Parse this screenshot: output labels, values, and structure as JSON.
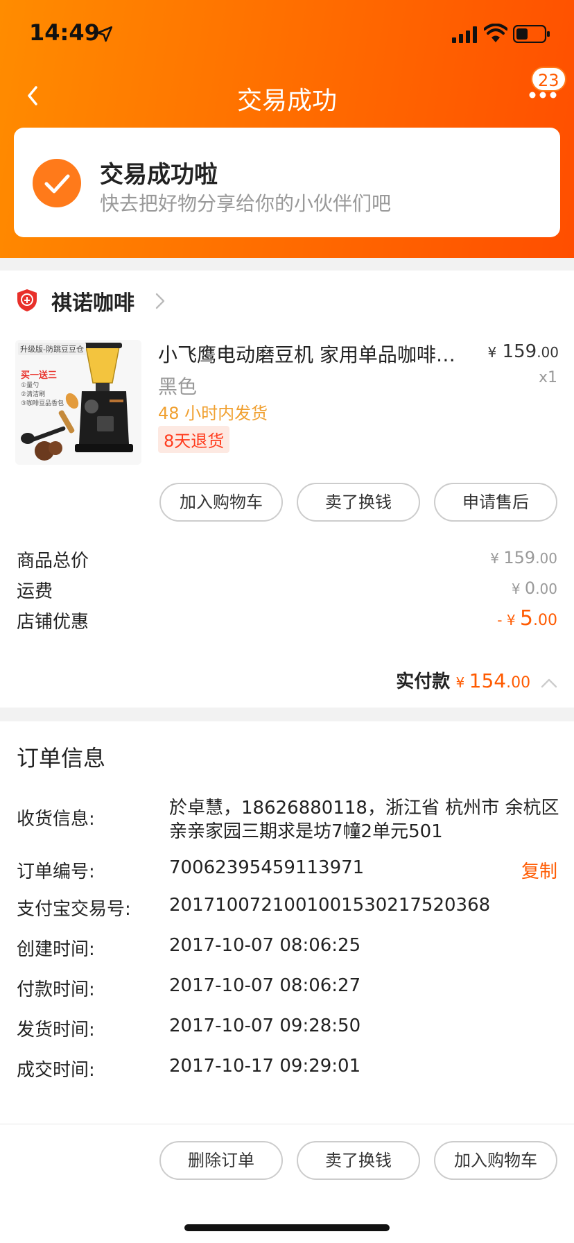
{
  "status_bar": {
    "time": "14:49"
  },
  "nav": {
    "title": "交易成功",
    "badge_count": "23"
  },
  "success": {
    "title": "交易成功啦",
    "subtitle": "快去把好物分享给你的小伙伴们吧"
  },
  "shop": {
    "name": "祺诺咖啡"
  },
  "product": {
    "name": "小飞鹰电动磨豆机 家用单品咖啡磨豆机",
    "price_symbol": "¥",
    "price_int": "159",
    "price_dec": ".00",
    "quantity": "x1",
    "color": "黑色",
    "shipping": "48 小时内发货",
    "return_policy": "8天退货",
    "image_texts": {
      "banner": "升级版-防跳豆豆仓",
      "promo": "买一送三",
      "gift1": "①量勺",
      "gift2": "②清洁刷",
      "gift3": "③咖啡豆品香包"
    }
  },
  "product_actions": [
    "加入购物车",
    "卖了换钱",
    "申请售后"
  ],
  "fees": [
    {
      "label": "商品总价",
      "prefix": "¥ ",
      "int": "159",
      "dec": ".00"
    },
    {
      "label": "运费",
      "prefix": "¥ ",
      "int": "0",
      "dec": ".00"
    },
    {
      "label": "店铺优惠",
      "prefix": "- ¥ ",
      "int": "5",
      "dec": ".00"
    }
  ],
  "paid": {
    "label": "实付款",
    "symbol": "¥ ",
    "int": "154",
    "dec": ".00"
  },
  "order_info": {
    "title": "订单信息",
    "address_label": "收货信息:",
    "address_line1": "於卓慧，18626880118，浙江省 杭州市 余杭区",
    "address_line2": "亲亲家园三期求是坊7幢2单元501",
    "order_no_label": "订单编号:",
    "order_no": "70062395459113971",
    "copy_label": "复制",
    "alipay_label": "支付宝交易号:",
    "alipay_no": "2017100721001001530217520368",
    "created_label": "创建时间:",
    "created": "2017-10-07 08:06:25",
    "paid_label": "付款时间:",
    "paid_time": "2017-10-07 08:06:27",
    "shipped_label": "发货时间:",
    "shipped": "2017-10-07 09:28:50",
    "closed_label": "成交时间:",
    "closed": "2017-10-17 09:29:01"
  },
  "bottom_actions": [
    "删除订单",
    "卖了换钱",
    "加入购物车"
  ],
  "colors": {
    "accent": "#ff5a00",
    "header_start": "#ff8c00",
    "header_end": "#ff4e00"
  }
}
